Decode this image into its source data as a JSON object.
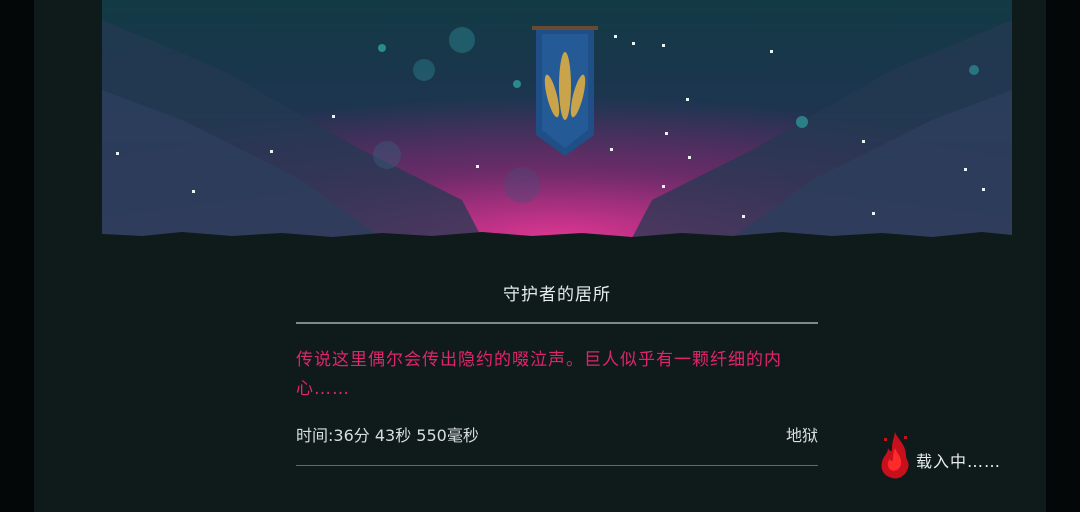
{
  "location": {
    "title": "守护者的居所",
    "description": "传说这里偶尔会传出隐约的啜泣声。巨人似乎有一颗纤细的内心……",
    "scene_icon": "guardian-banner-icon"
  },
  "stats": {
    "time": "时间:36分 43秒 550毫秒",
    "difficulty": "地狱"
  },
  "loading": {
    "text": "载入中……",
    "icon": "red-flame-icon"
  },
  "colors": {
    "accent": "#e0246e",
    "text": "#e6ecec",
    "background": "#0f1a1b"
  }
}
